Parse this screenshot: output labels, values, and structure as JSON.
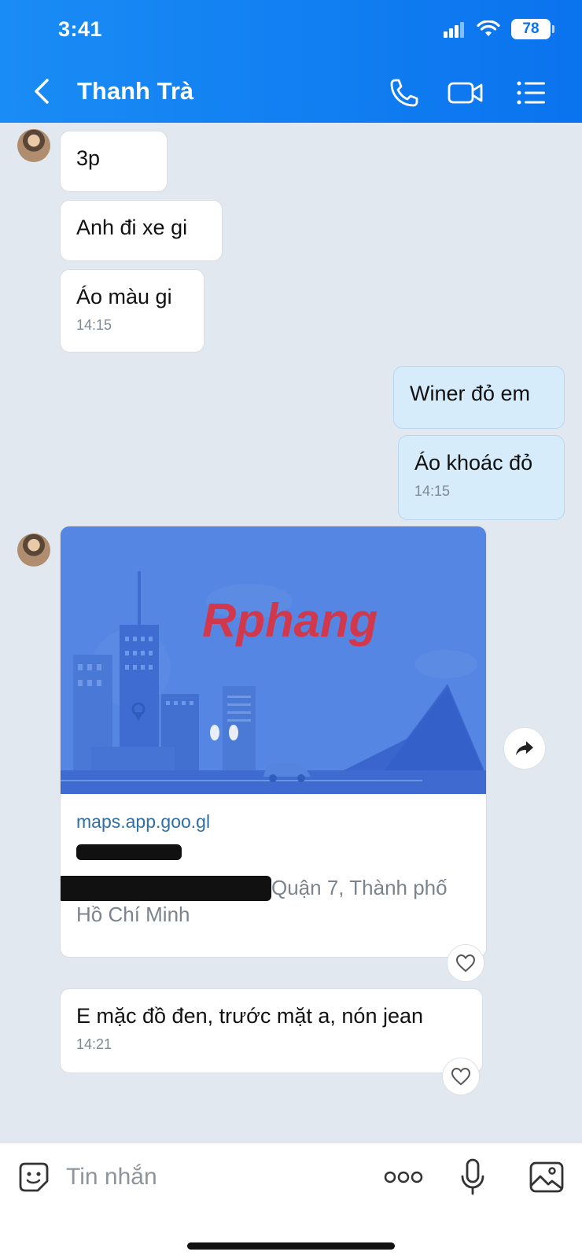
{
  "status_bar": {
    "time": "3:41",
    "battery": "78"
  },
  "header": {
    "title": "Thanh Trà"
  },
  "messages": [
    {
      "text": "3p"
    },
    {
      "text": "Anh đi xe gi"
    },
    {
      "text": "Áo màu gi",
      "time": "14:15"
    },
    {
      "text": "Winer đỏ em"
    },
    {
      "text": "Áo khoác đỏ",
      "time": "14:15"
    }
  ],
  "link_card": {
    "watermark": "Rphang",
    "domain": "maps.app.goo.gl",
    "address_line1": "Quận 7, Thành phố",
    "address_line2": "Hồ Chí Minh"
  },
  "last_message": {
    "text": "E mặc đồ đen, trước mặt a, nón jean",
    "time": "14:21"
  },
  "input": {
    "placeholder": "Tin nhắn"
  },
  "colors": {
    "header": "#0a73ee",
    "sent_bubble": "#d6ecfb",
    "background": "#e2e8ef"
  }
}
